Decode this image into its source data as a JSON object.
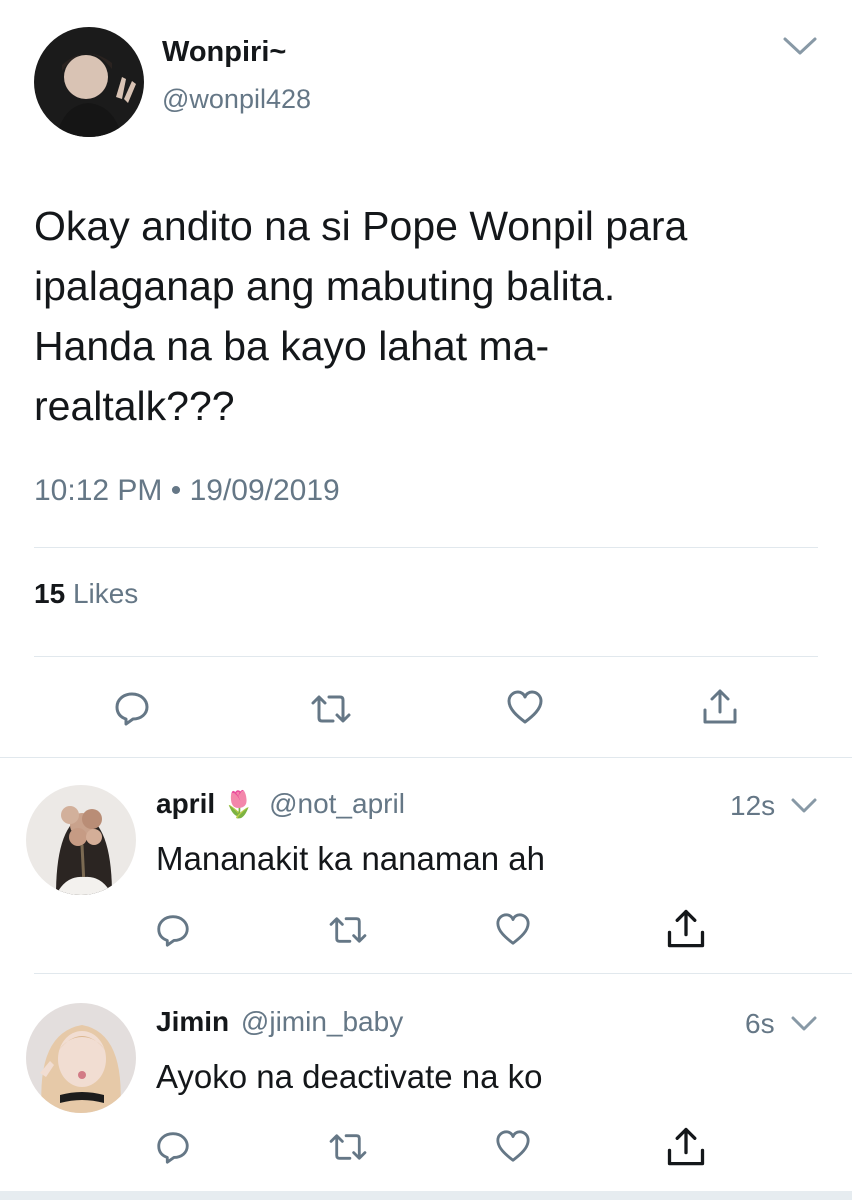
{
  "main_tweet": {
    "display_name": "Wonpiri~",
    "handle": "@wonpil428",
    "text_lines": [
      "Okay andito na si Pope Wonpil para",
      "ipalaganap ang mabuting balita.",
      "Handa na ba kayo lahat ma-",
      "realtalk???"
    ],
    "timestamp": "10:12 PM • 19/09/2019",
    "likes_count": "15",
    "likes_label": "Likes"
  },
  "replies": [
    {
      "display_name": "april",
      "emoji": "🌷",
      "handle": "@not_april",
      "time": "12s",
      "text": "Mananakit ka nanaman ah"
    },
    {
      "display_name": "Jimin",
      "handle": "@jimin_baby",
      "time": "6s",
      "text": "Ayoko na deactivate na ko"
    }
  ],
  "icons": {
    "reply": "reply-icon",
    "retweet": "retweet-icon",
    "like": "heart-icon",
    "share": "share-icon",
    "more": "chevron-down-icon"
  },
  "colors": {
    "text": "#14171a",
    "muted": "#657786",
    "divider": "#e1e8ed"
  }
}
